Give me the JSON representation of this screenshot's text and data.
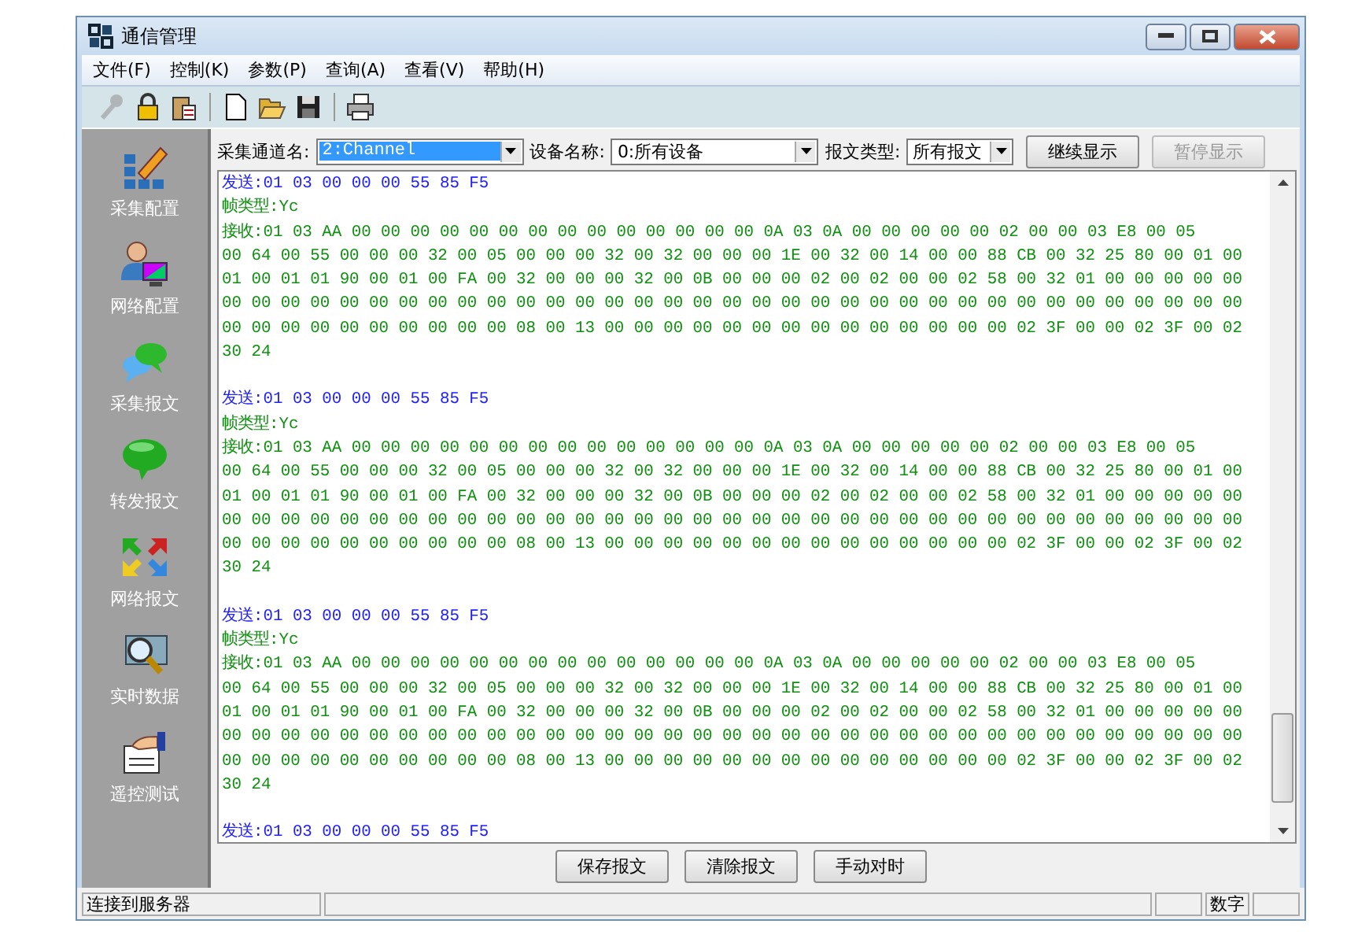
{
  "window": {
    "title": "通信管理"
  },
  "menu": [
    "文件(F)",
    "控制(K)",
    "参数(P)",
    "查询(A)",
    "查看(V)",
    "帮助(H)"
  ],
  "toolbar": [
    {
      "kind": "key",
      "disabled": true
    },
    {
      "kind": "lock",
      "disabled": false
    },
    {
      "kind": "clipboard",
      "disabled": false
    },
    {
      "kind": "new",
      "disabled": false
    },
    {
      "kind": "open",
      "disabled": false
    },
    {
      "kind": "save",
      "disabled": false
    },
    {
      "kind": "print",
      "disabled": false
    }
  ],
  "sidebar": [
    {
      "kind": "config",
      "label": "采集配置"
    },
    {
      "kind": "user",
      "label": "网络配置"
    },
    {
      "kind": "bubbles",
      "label": "采集报文"
    },
    {
      "kind": "bubble",
      "label": "转发报文"
    },
    {
      "kind": "arrows",
      "label": "网络报文"
    },
    {
      "kind": "magnifier",
      "label": "实时数据"
    },
    {
      "kind": "hand",
      "label": "遥控测试"
    }
  ],
  "filters": [
    {
      "label": "采集通道名:",
      "value": "2:Channel",
      "focused": true
    },
    {
      "label": "设备名称:",
      "value": "0:所有设备",
      "focused": false
    },
    {
      "label": "报文类型:",
      "value": "所有报文",
      "focused": false
    }
  ],
  "view_buttons": [
    {
      "label": "继续显示",
      "disabled": false
    },
    {
      "label": "暂停显示",
      "disabled": true
    }
  ],
  "log": [
    {
      "send": "发送:01 03 00 00 00 55 85 F5",
      "frame_type": "帧类型:Yc",
      "receive": [
        "接收:01 03 AA 00 00 00 00 00 00 00 00 00 00 00 00 00 00 0A 03 0A 00 00 00 00 00 02 00 00 03 E8 00 05",
        "00 64 00 55 00 00 00 32 00 05 00 00 00 32 00 32 00 00 00 1E 00 32 00 14 00 00 88 CB 00 32 25 80 00 01 00",
        "01 00 01 01 90 00 01 00 FA 00 32 00 00 00 32 00 0B 00 00 00 02 00 02 00 00 02 58 00 32 01 00 00 00 00 00",
        "00 00 00 00 00 00 00 00 00 00 00 00 00 00 00 00 00 00 00 00 00 00 00 00 00 00 00 00 00 00 00 00 00 00 00",
        "00 00 00 00 00 00 00 00 00 00 08 00 13 00 00 00 00 00 00 00 00 00 00 00 00 00 00 02 3F 00 00 02 3F 00 02",
        "30 24"
      ]
    },
    {
      "send": "发送:01 03 00 00 00 55 85 F5",
      "frame_type": "帧类型:Yc",
      "receive": [
        "接收:01 03 AA 00 00 00 00 00 00 00 00 00 00 00 00 00 00 0A 03 0A 00 00 00 00 00 02 00 00 03 E8 00 05",
        "00 64 00 55 00 00 00 32 00 05 00 00 00 32 00 32 00 00 00 1E 00 32 00 14 00 00 88 CB 00 32 25 80 00 01 00",
        "01 00 01 01 90 00 01 00 FA 00 32 00 00 00 32 00 0B 00 00 00 02 00 02 00 00 02 58 00 32 01 00 00 00 00 00",
        "00 00 00 00 00 00 00 00 00 00 00 00 00 00 00 00 00 00 00 00 00 00 00 00 00 00 00 00 00 00 00 00 00 00 00",
        "00 00 00 00 00 00 00 00 00 00 08 00 13 00 00 00 00 00 00 00 00 00 00 00 00 00 00 02 3F 00 00 02 3F 00 02",
        "30 24"
      ]
    },
    {
      "send": "发送:01 03 00 00 00 55 85 F5",
      "frame_type": "帧类型:Yc",
      "receive": [
        "接收:01 03 AA 00 00 00 00 00 00 00 00 00 00 00 00 00 00 0A 03 0A 00 00 00 00 00 02 00 00 03 E8 00 05",
        "00 64 00 55 00 00 00 32 00 05 00 00 00 32 00 32 00 00 00 1E 00 32 00 14 00 00 88 CB 00 32 25 80 00 01 00",
        "01 00 01 01 90 00 01 00 FA 00 32 00 00 00 32 00 0B 00 00 00 02 00 02 00 00 02 58 00 32 01 00 00 00 00 00",
        "00 00 00 00 00 00 00 00 00 00 00 00 00 00 00 00 00 00 00 00 00 00 00 00 00 00 00 00 00 00 00 00 00 00 00",
        "00 00 00 00 00 00 00 00 00 00 08 00 13 00 00 00 00 00 00 00 00 00 00 00 00 00 00 02 3F 00 00 02 3F 00 02",
        "30 24"
      ]
    },
    {
      "send": "发送:01 03 00 00 00 55 85 F5"
    }
  ],
  "actions": [
    "保存报文",
    "清除报文",
    "手动对时"
  ],
  "status_bar": [
    {
      "kind": "text",
      "text": "连接到服务器"
    },
    {
      "kind": "wide"
    },
    {
      "kind": "small"
    },
    {
      "kind": "text",
      "text": "数字"
    },
    {
      "kind": "small"
    }
  ]
}
